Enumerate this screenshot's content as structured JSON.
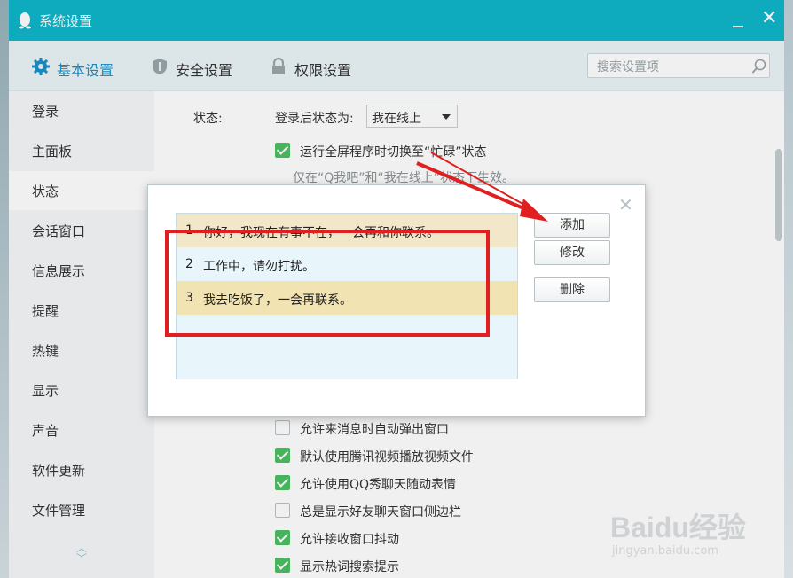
{
  "window": {
    "title": "系统设置"
  },
  "tabs": [
    {
      "label": "基本设置",
      "icon": "gear-icon"
    },
    {
      "label": "安全设置",
      "icon": "shield-icon"
    },
    {
      "label": "权限设置",
      "icon": "lock-icon"
    }
  ],
  "search": {
    "placeholder": "搜索设置项"
  },
  "sidebar": {
    "items": [
      {
        "label": "登录"
      },
      {
        "label": "主面板"
      },
      {
        "label": "状态",
        "active": true
      },
      {
        "label": "会话窗口"
      },
      {
        "label": "信息展示"
      },
      {
        "label": "提醒"
      },
      {
        "label": "热键"
      },
      {
        "label": "显示"
      },
      {
        "label": "声音"
      },
      {
        "label": "软件更新"
      },
      {
        "label": "文件管理"
      }
    ]
  },
  "status": {
    "label": "状态:",
    "after_login_label": "登录后状态为:",
    "after_login_value": "我在线上",
    "fullscreen_busy": {
      "label": "运行全屏程序时切换至“忙碌”状态",
      "checked": true
    },
    "hint": "仅在“Q我吧”和“我在线上”状态下生效。"
  },
  "options": [
    {
      "label": "允许来消息时自动弹出窗口",
      "checked": false
    },
    {
      "label": "默认使用腾讯视频播放视频文件",
      "checked": true
    },
    {
      "label": "允许使用QQ秀聊天随动表情",
      "checked": true
    },
    {
      "label": "总是显示好友聊天窗口侧边栏",
      "checked": false
    },
    {
      "label": "允许接收窗口抖动",
      "checked": true
    },
    {
      "label": "显示热词搜索提示",
      "checked": true
    }
  ],
  "dialog": {
    "replies": [
      {
        "num": "1",
        "text": "你好，我现在有事不在，一会再和你联系。"
      },
      {
        "num": "2",
        "text": "工作中，请勿打扰。"
      },
      {
        "num": "3",
        "text": "我去吃饭了，一会再联系。"
      }
    ],
    "buttons": {
      "add": "添加",
      "edit": "修改",
      "delete": "删除"
    }
  },
  "watermark": {
    "logo": "Baidu经验",
    "url": "jingyan.baidu.com"
  },
  "colors": {
    "titlebar": "#0fb5c9",
    "accent": "#1a90c8",
    "check": "#4cbf63",
    "highlight": "#e02020"
  }
}
